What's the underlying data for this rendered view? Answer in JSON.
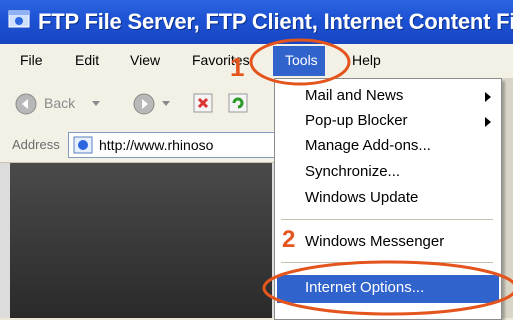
{
  "window": {
    "title": "FTP File Server, FTP Client, Internet Content Fi"
  },
  "menubar": {
    "items": [
      "File",
      "Edit",
      "View",
      "Favorites",
      "Tools",
      "Help"
    ],
    "active": "Tools"
  },
  "toolbar": {
    "back_label": "Back"
  },
  "address_bar": {
    "label": "Address",
    "value": "http://www.rhinoso"
  },
  "tools_menu": {
    "items": [
      {
        "label": "Mail and News",
        "submenu": true
      },
      {
        "label": "Pop-up Blocker",
        "submenu": true
      },
      {
        "label": "Manage Add-ons...",
        "submenu": false
      },
      {
        "label": "Synchronize...",
        "submenu": false
      },
      {
        "label": "Windows Update",
        "submenu": false
      },
      {
        "label": "Windows Messenger",
        "submenu": false
      },
      {
        "label": "Internet Options...",
        "submenu": false,
        "highlighted": true
      }
    ]
  },
  "annotations": {
    "step1": "1",
    "step2": "2",
    "color": "#e4551e"
  },
  "colors": {
    "titlebar": "#1d52d4",
    "highlight": "#3163cc"
  }
}
